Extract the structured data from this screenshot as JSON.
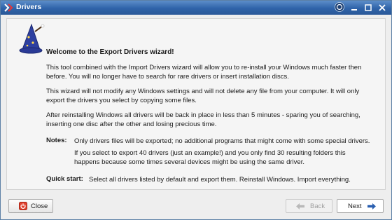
{
  "window": {
    "title": "Drivers"
  },
  "content": {
    "heading": "Welcome to the Export Drivers wizard!",
    "para1": "This tool combined with the Import Drivers wizard will allow you to re-install your Windows much faster then before. You will no longer have to search for rare drivers or insert installation discs.",
    "para2": "This wizard will not modify any Windows settings and will not delete any file from your computer. It will only export the drivers you select by copying some files.",
    "para3": "After reinstalling Windows all drivers will be back in place in less than 5 minutes - sparing you of searching, inserting one disc after the other and losing precious time.",
    "notes_label": "Notes:",
    "notes_1": "Only drivers files will be exported; no additional programs that might come with some special drivers.",
    "notes_2": "If you select to export 40 drivers (just an example!) and you only find 30 resulting folders this happens because some times several devices might be using the same driver.",
    "quick_label": "Quick start:",
    "quick_text": "Select all drivers listed by default and export them. Reinstall Windows. Import everything."
  },
  "buttons": {
    "close": "Close",
    "back": "Back",
    "next": "Next"
  },
  "icons": {
    "app": "app-logo-icon",
    "help": "help-icon",
    "minimize": "minimize-icon",
    "maximize": "maximize-icon",
    "close": "close-icon",
    "wizard": "wizard-hat-icon",
    "close_button": "power-icon",
    "back": "back-arrow-icon",
    "next": "next-arrow-icon"
  },
  "colors": {
    "titlebar": "#2f63a9",
    "accent": "#2a5fb0"
  }
}
